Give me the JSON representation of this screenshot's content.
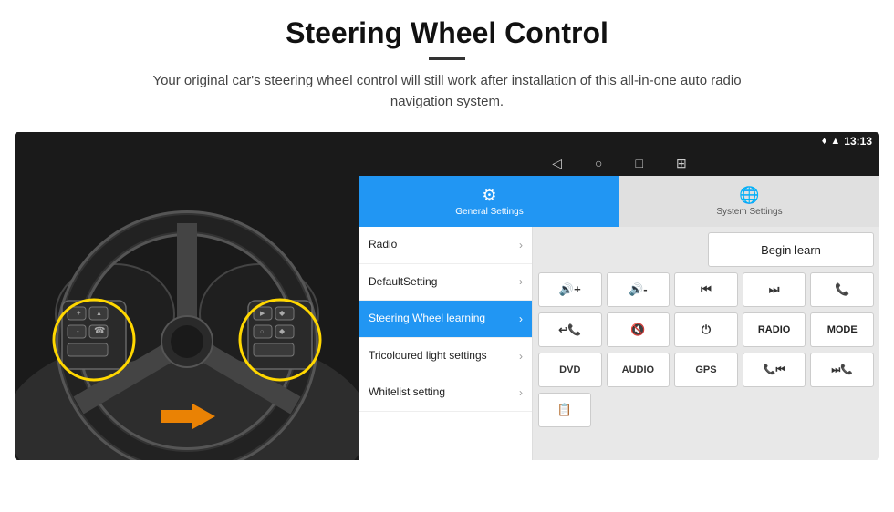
{
  "header": {
    "title": "Steering Wheel Control",
    "divider": true,
    "subtitle": "Your original car's steering wheel control will still work after installation of this all-in-one auto radio navigation system."
  },
  "status_bar": {
    "time": "13:13",
    "icons": [
      "location",
      "wifi",
      "signal"
    ]
  },
  "nav_bar": {
    "icons": [
      "back",
      "home",
      "square",
      "grid"
    ]
  },
  "tabs": [
    {
      "id": "general",
      "label": "General Settings",
      "icon": "⚙",
      "active": true
    },
    {
      "id": "system",
      "label": "System Settings",
      "icon": "🌐",
      "active": false
    }
  ],
  "menu": {
    "items": [
      {
        "label": "Radio",
        "active": false
      },
      {
        "label": "DefaultSetting",
        "active": false
      },
      {
        "label": "Steering Wheel learning",
        "active": true
      },
      {
        "label": "Tricoloured light settings",
        "active": false
      },
      {
        "label": "Whitelist setting",
        "active": false
      }
    ]
  },
  "control_panel": {
    "begin_learn_label": "Begin learn",
    "row1": [
      {
        "icon": "🔊+",
        "type": "icon"
      },
      {
        "icon": "🔊-",
        "type": "icon"
      },
      {
        "icon": "⏮",
        "type": "icon"
      },
      {
        "icon": "⏭",
        "type": "icon"
      },
      {
        "icon": "📞",
        "type": "icon"
      }
    ],
    "row2": [
      {
        "icon": "📞↩",
        "type": "icon"
      },
      {
        "icon": "🔇",
        "type": "icon"
      },
      {
        "label": "⏻",
        "type": "icon"
      },
      {
        "label": "RADIO",
        "type": "text"
      },
      {
        "label": "MODE",
        "type": "text"
      }
    ],
    "row3": [
      {
        "label": "DVD",
        "type": "text"
      },
      {
        "label": "AUDIO",
        "type": "text"
      },
      {
        "label": "GPS",
        "type": "text"
      },
      {
        "icon": "📞⏮",
        "type": "icon"
      },
      {
        "icon": "⏭📞",
        "type": "icon"
      }
    ],
    "row4_icon": "📋"
  }
}
